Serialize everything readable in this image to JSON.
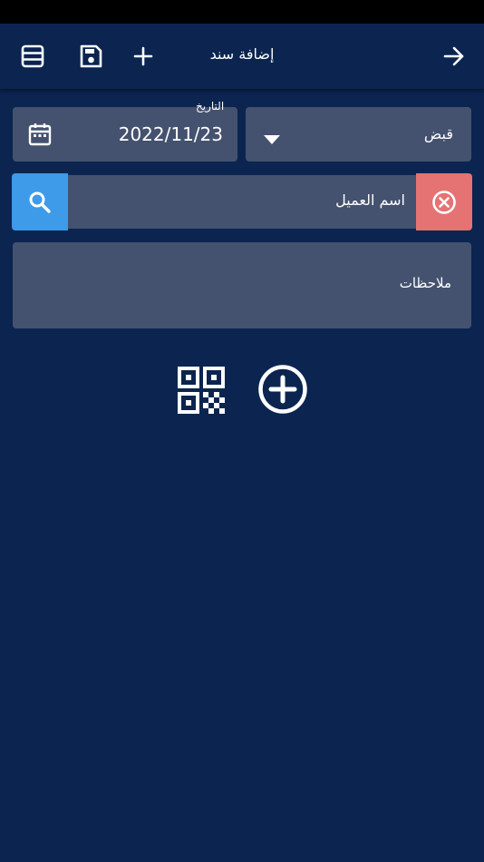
{
  "header": {
    "title": "إضافة سند"
  },
  "form": {
    "date_label": "التاريخ",
    "date_value": "2022/11/23",
    "type_value": "قبض",
    "customer_name": "اسم العميل",
    "notes_placeholder": "ملاحظات"
  },
  "icons": {
    "list": "list-icon",
    "save": "save-icon",
    "add": "plus-icon",
    "back": "arrow-right-icon",
    "calendar": "calendar-icon",
    "dropdown": "caret-down-icon",
    "search": "search-icon",
    "clear": "close-circle-icon",
    "qr": "qr-code-icon",
    "add_item": "add-circle-icon"
  },
  "colors": {
    "background": "#0b2550",
    "field": "#44526f",
    "search_button": "#3d9be9",
    "clear_button": "#e57373"
  }
}
